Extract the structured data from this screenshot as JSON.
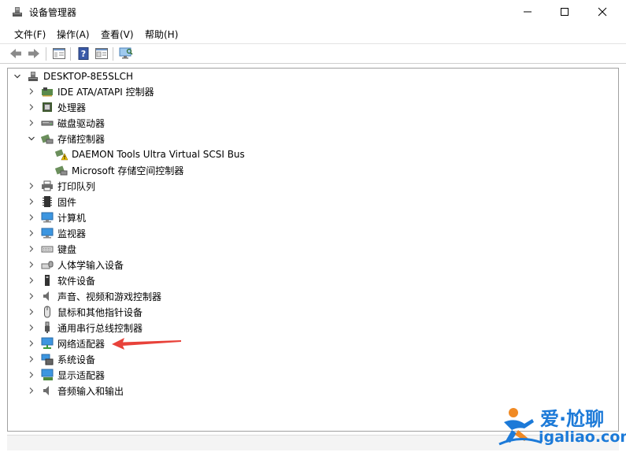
{
  "window": {
    "title": "设备管理器"
  },
  "menu": {
    "items": [
      "文件(F)",
      "操作(A)",
      "查看(V)",
      "帮助(H)"
    ]
  },
  "tree": {
    "root": "DESKTOP-8E5SLCH",
    "items": [
      {
        "label": "IDE ATA/ATAPI 控制器",
        "icon": "ide-controller-icon",
        "expanded": false
      },
      {
        "label": "处理器",
        "icon": "processor-icon",
        "expanded": false
      },
      {
        "label": "磁盘驱动器",
        "icon": "disk-drive-icon",
        "expanded": false
      },
      {
        "label": "存储控制器",
        "icon": "storage-controller-icon",
        "expanded": true,
        "children": [
          {
            "label": "DAEMON Tools Ultra Virtual SCSI Bus",
            "icon": "storage-warning-icon"
          },
          {
            "label": "Microsoft 存储空间控制器",
            "icon": "storage-device-icon"
          }
        ]
      },
      {
        "label": "打印队列",
        "icon": "printer-icon",
        "expanded": false
      },
      {
        "label": "固件",
        "icon": "firmware-icon",
        "expanded": false
      },
      {
        "label": "计算机",
        "icon": "computer-icon",
        "expanded": false
      },
      {
        "label": "监视器",
        "icon": "monitor-icon",
        "expanded": false
      },
      {
        "label": "键盘",
        "icon": "keyboard-icon",
        "expanded": false
      },
      {
        "label": "人体学输入设备",
        "icon": "hid-icon",
        "expanded": false
      },
      {
        "label": "软件设备",
        "icon": "software-device-icon",
        "expanded": false
      },
      {
        "label": "声音、视频和游戏控制器",
        "icon": "sound-icon",
        "expanded": false
      },
      {
        "label": "鼠标和其他指针设备",
        "icon": "mouse-icon",
        "expanded": false
      },
      {
        "label": "通用串行总线控制器",
        "icon": "usb-icon",
        "expanded": false
      },
      {
        "label": "网络适配器",
        "icon": "network-adapter-icon",
        "expanded": false
      },
      {
        "label": "系统设备",
        "icon": "system-device-icon",
        "expanded": false
      },
      {
        "label": "显示适配器",
        "icon": "display-adapter-icon",
        "expanded": false
      },
      {
        "label": "音频输入和输出",
        "icon": "audio-io-icon",
        "expanded": false
      }
    ]
  },
  "watermark": {
    "cn": "爱·尬聊",
    "en": "igaliao.com"
  },
  "colors": {
    "annotation_arrow": "#e8423a",
    "watermark": "#1c7ad8",
    "frame_border": "#a0a0a0"
  }
}
